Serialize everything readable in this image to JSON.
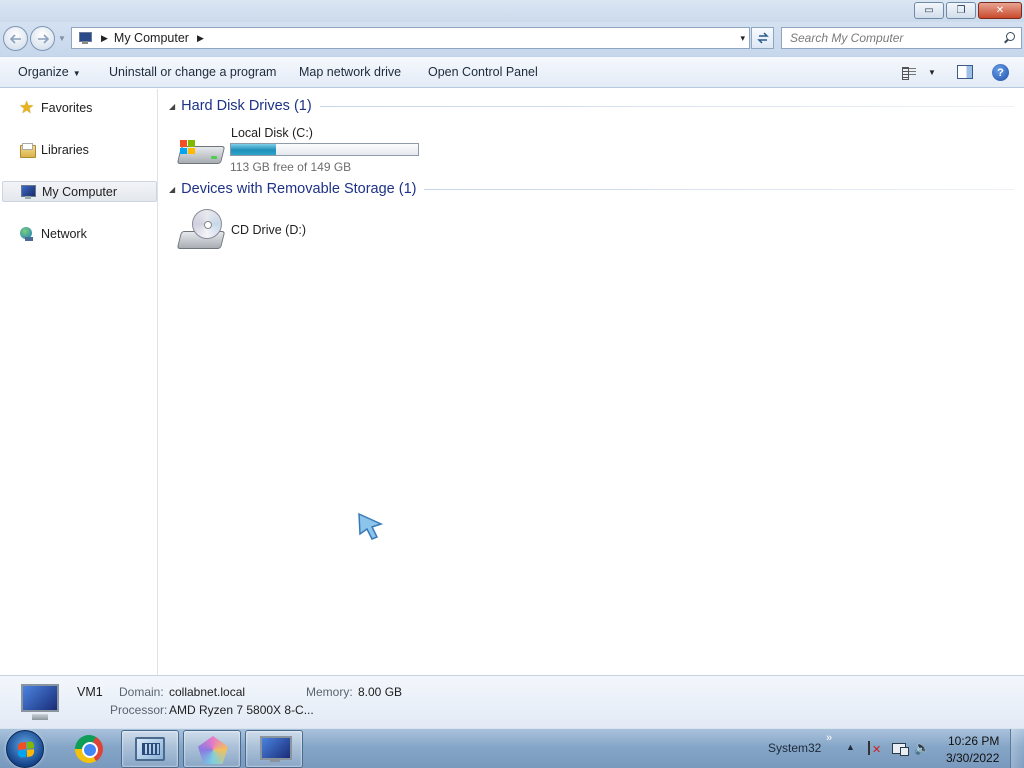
{
  "window": {
    "minimize_glyph": "▭",
    "maximize_glyph": "❐",
    "close_glyph": "✕"
  },
  "address": {
    "crumb": "My Computer",
    "sep": "▶",
    "dropdown": "▾",
    "refresh_glyph": "↹"
  },
  "search": {
    "placeholder": "Search My Computer"
  },
  "toolbar": {
    "organize": "Organize",
    "organize_arrow": "▼",
    "uninstall": "Uninstall or change a program",
    "map_drive": "Map network drive",
    "control_panel": "Open Control Panel",
    "views_dropdown": "▼",
    "help": "?"
  },
  "sidebar": {
    "items": [
      {
        "label": "Favorites",
        "icon": "star-icon"
      },
      {
        "label": "Libraries",
        "icon": "libraries-icon"
      },
      {
        "label": "My Computer",
        "icon": "computer-icon",
        "selected": true
      },
      {
        "label": "Network",
        "icon": "network-icon"
      }
    ]
  },
  "groups": [
    {
      "title": "Hard Disk Drives (1)",
      "triangle": "◢",
      "drives": [
        {
          "name": "Local Disk (C:)",
          "free_text": "113 GB free of 149 GB",
          "used_fraction": 0.24
        }
      ]
    },
    {
      "title": "Devices with Removable Storage (1)",
      "triangle": "◢",
      "drives": [
        {
          "name": "CD Drive (D:)"
        }
      ]
    }
  ],
  "details": {
    "name": "VM1",
    "domain_label": "Domain:",
    "domain": "collabnet.local",
    "memory_label": "Memory:",
    "memory": "8.00 GB",
    "processor_label": "Processor:",
    "processor": "AMD Ryzen 7 5800X 8-C..."
  },
  "taskbar": {
    "apps": [
      "chrome-icon",
      "remote-desktop-icon",
      "paint-icon",
      "my-computer-icon"
    ],
    "tray_label": "System32",
    "tray_chevron": "»",
    "tray_up": "▲",
    "volume_glyph": "🔈",
    "time": "10:26 PM",
    "date": "3/30/2022"
  },
  "colors": {
    "group_title": "#1e3287",
    "usage_fill": "#1e8fb8",
    "window_chrome": "#cbdaec"
  }
}
